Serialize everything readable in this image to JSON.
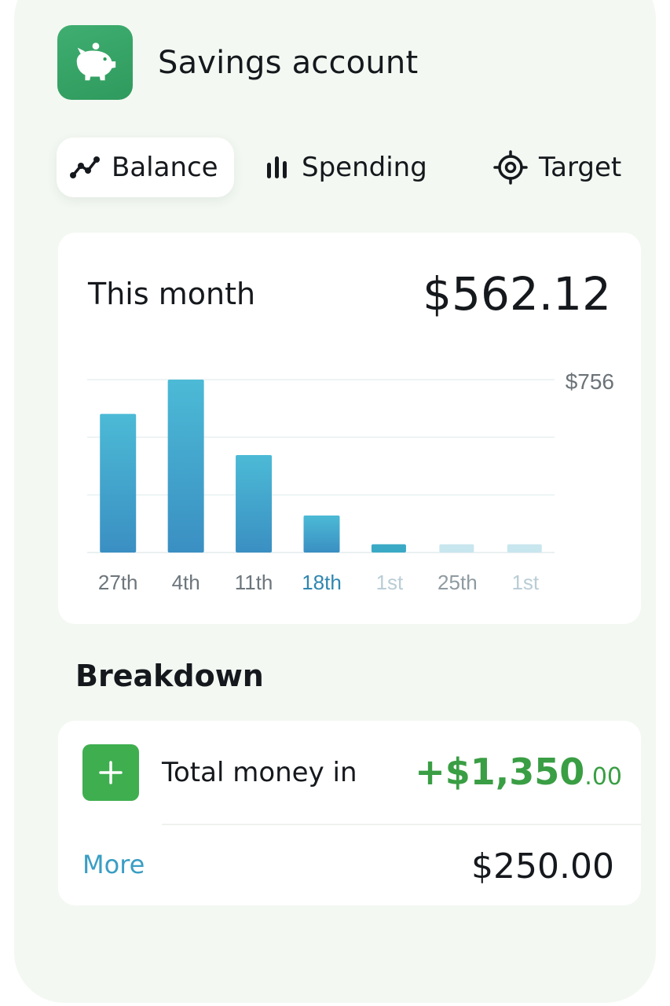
{
  "app": {
    "title": "Savings account",
    "icon": "piggy-bank-icon",
    "accent_color": "#3aa765"
  },
  "tabs": [
    {
      "label": "Balance",
      "icon": "line-graph-icon",
      "active": true
    },
    {
      "label": "Spending",
      "icon": "bar-chart-icon",
      "active": false
    },
    {
      "label": "Target",
      "icon": "target-icon",
      "active": false
    }
  ],
  "month_card": {
    "label": "This month",
    "amount": "$562.12",
    "max_label": "$756"
  },
  "chart_data": {
    "type": "bar",
    "categories": [
      "27th",
      "4th",
      "11th",
      "18th",
      "1st",
      "25th",
      "1st"
    ],
    "values": [
      606,
      756,
      426,
      162,
      36,
      36,
      36
    ],
    "ylim": [
      0,
      756
    ],
    "selected_category": "18th",
    "future_categories": [
      "1st",
      "25th",
      "1st"
    ],
    "grid": true,
    "colors": {
      "bar": "#3fa7cc",
      "bar_future": "#c8e6ee",
      "selected_label": "#2f86b0"
    }
  },
  "breakdown": {
    "heading": "Breakdown",
    "money_in": {
      "label": "Total money in",
      "amount_main": "+$1,350",
      "amount_cents": ".00",
      "icon": "plus-icon",
      "color": "#3a9e44"
    },
    "more": {
      "label": "More",
      "amount": "$250.00"
    }
  }
}
